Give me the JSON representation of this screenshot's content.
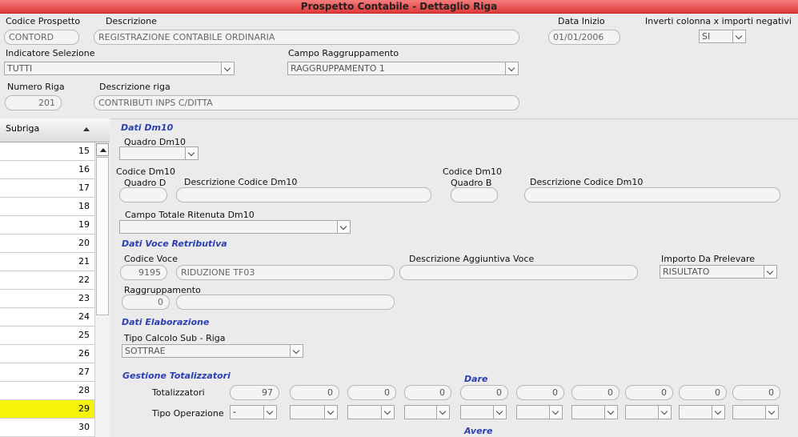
{
  "title": "Prospetto Contabile - Dettaglio Riga",
  "header": {
    "codice_prospetto_label": "Codice Prospetto",
    "codice_prospetto_value": "CONTORD",
    "descrizione_label": "Descrizione",
    "descrizione_value": "REGISTRAZIONE CONTABILE ORDINARIA",
    "data_inizio_label": "Data Inizio",
    "data_inizio_value": "01/01/2006",
    "inverti_label": "Inverti colonna x importi negativi",
    "inverti_value": "SI",
    "indicatore_label": "Indicatore Selezione",
    "indicatore_value": "TUTTI",
    "campo_raggr_label": "Campo Raggruppamento",
    "campo_raggr_value": "RAGGRUPPAMENTO 1",
    "numero_riga_label": "Numero Riga",
    "numero_riga_value": "201",
    "descr_riga_label": "Descrizione riga",
    "descr_riga_value": "CONTRIBUTI INPS C/DITTA"
  },
  "subriga": {
    "header": "Subriga",
    "rows": [
      "15",
      "16",
      "17",
      "18",
      "19",
      "20",
      "21",
      "22",
      "23",
      "24",
      "25",
      "26",
      "27",
      "28",
      "29",
      "30"
    ],
    "selected": "29"
  },
  "dm10": {
    "section": "Dati Dm10",
    "quadro_label": "Quadro Dm10",
    "quadro_value": "",
    "codice_d_label1": "Codice Dm10",
    "codice_d_label2": "Quadro D",
    "codice_d_value": "",
    "descr_d_label": "Descrizione Codice Dm10",
    "descr_d_value": "",
    "codice_b_label1": "Codice Dm10",
    "codice_b_label2": "Quadro B",
    "codice_b_value": "",
    "descr_b_label": "Descrizione Codice Dm10",
    "descr_b_value": "",
    "campo_totale_label": "Campo Totale Ritenuta Dm10",
    "campo_totale_value": ""
  },
  "voce": {
    "section": "Dati Voce Retributiva",
    "codice_label": "Codice Voce",
    "codice_value": "9195",
    "codice_descr": "RIDUZIONE TF03",
    "descr_agg_label": "Descrizione Aggiuntiva Voce",
    "descr_agg_value": "",
    "importo_label": "Importo Da Prelevare",
    "importo_value": "RISULTATO",
    "raggr_label": "Raggruppamento",
    "raggr_value": "0",
    "raggr_descr": ""
  },
  "elab": {
    "section": "Dati Elaborazione",
    "tipo_calcolo_label": "Tipo Calcolo Sub - Riga",
    "tipo_calcolo_value": "SOTTRAE"
  },
  "totalizzatori": {
    "section": "Gestione Totalizzatori",
    "dare_label": "Dare",
    "avere_label": "Avere",
    "tot_label": "Totalizzatori",
    "tipo_op_label": "Tipo Operazione",
    "values": [
      "97",
      "0",
      "0",
      "0",
      "0",
      "0",
      "0",
      "0",
      "0",
      "0"
    ],
    "ops": [
      "-",
      "",
      "",
      "",
      "",
      "",
      "",
      "",
      "",
      ""
    ]
  }
}
